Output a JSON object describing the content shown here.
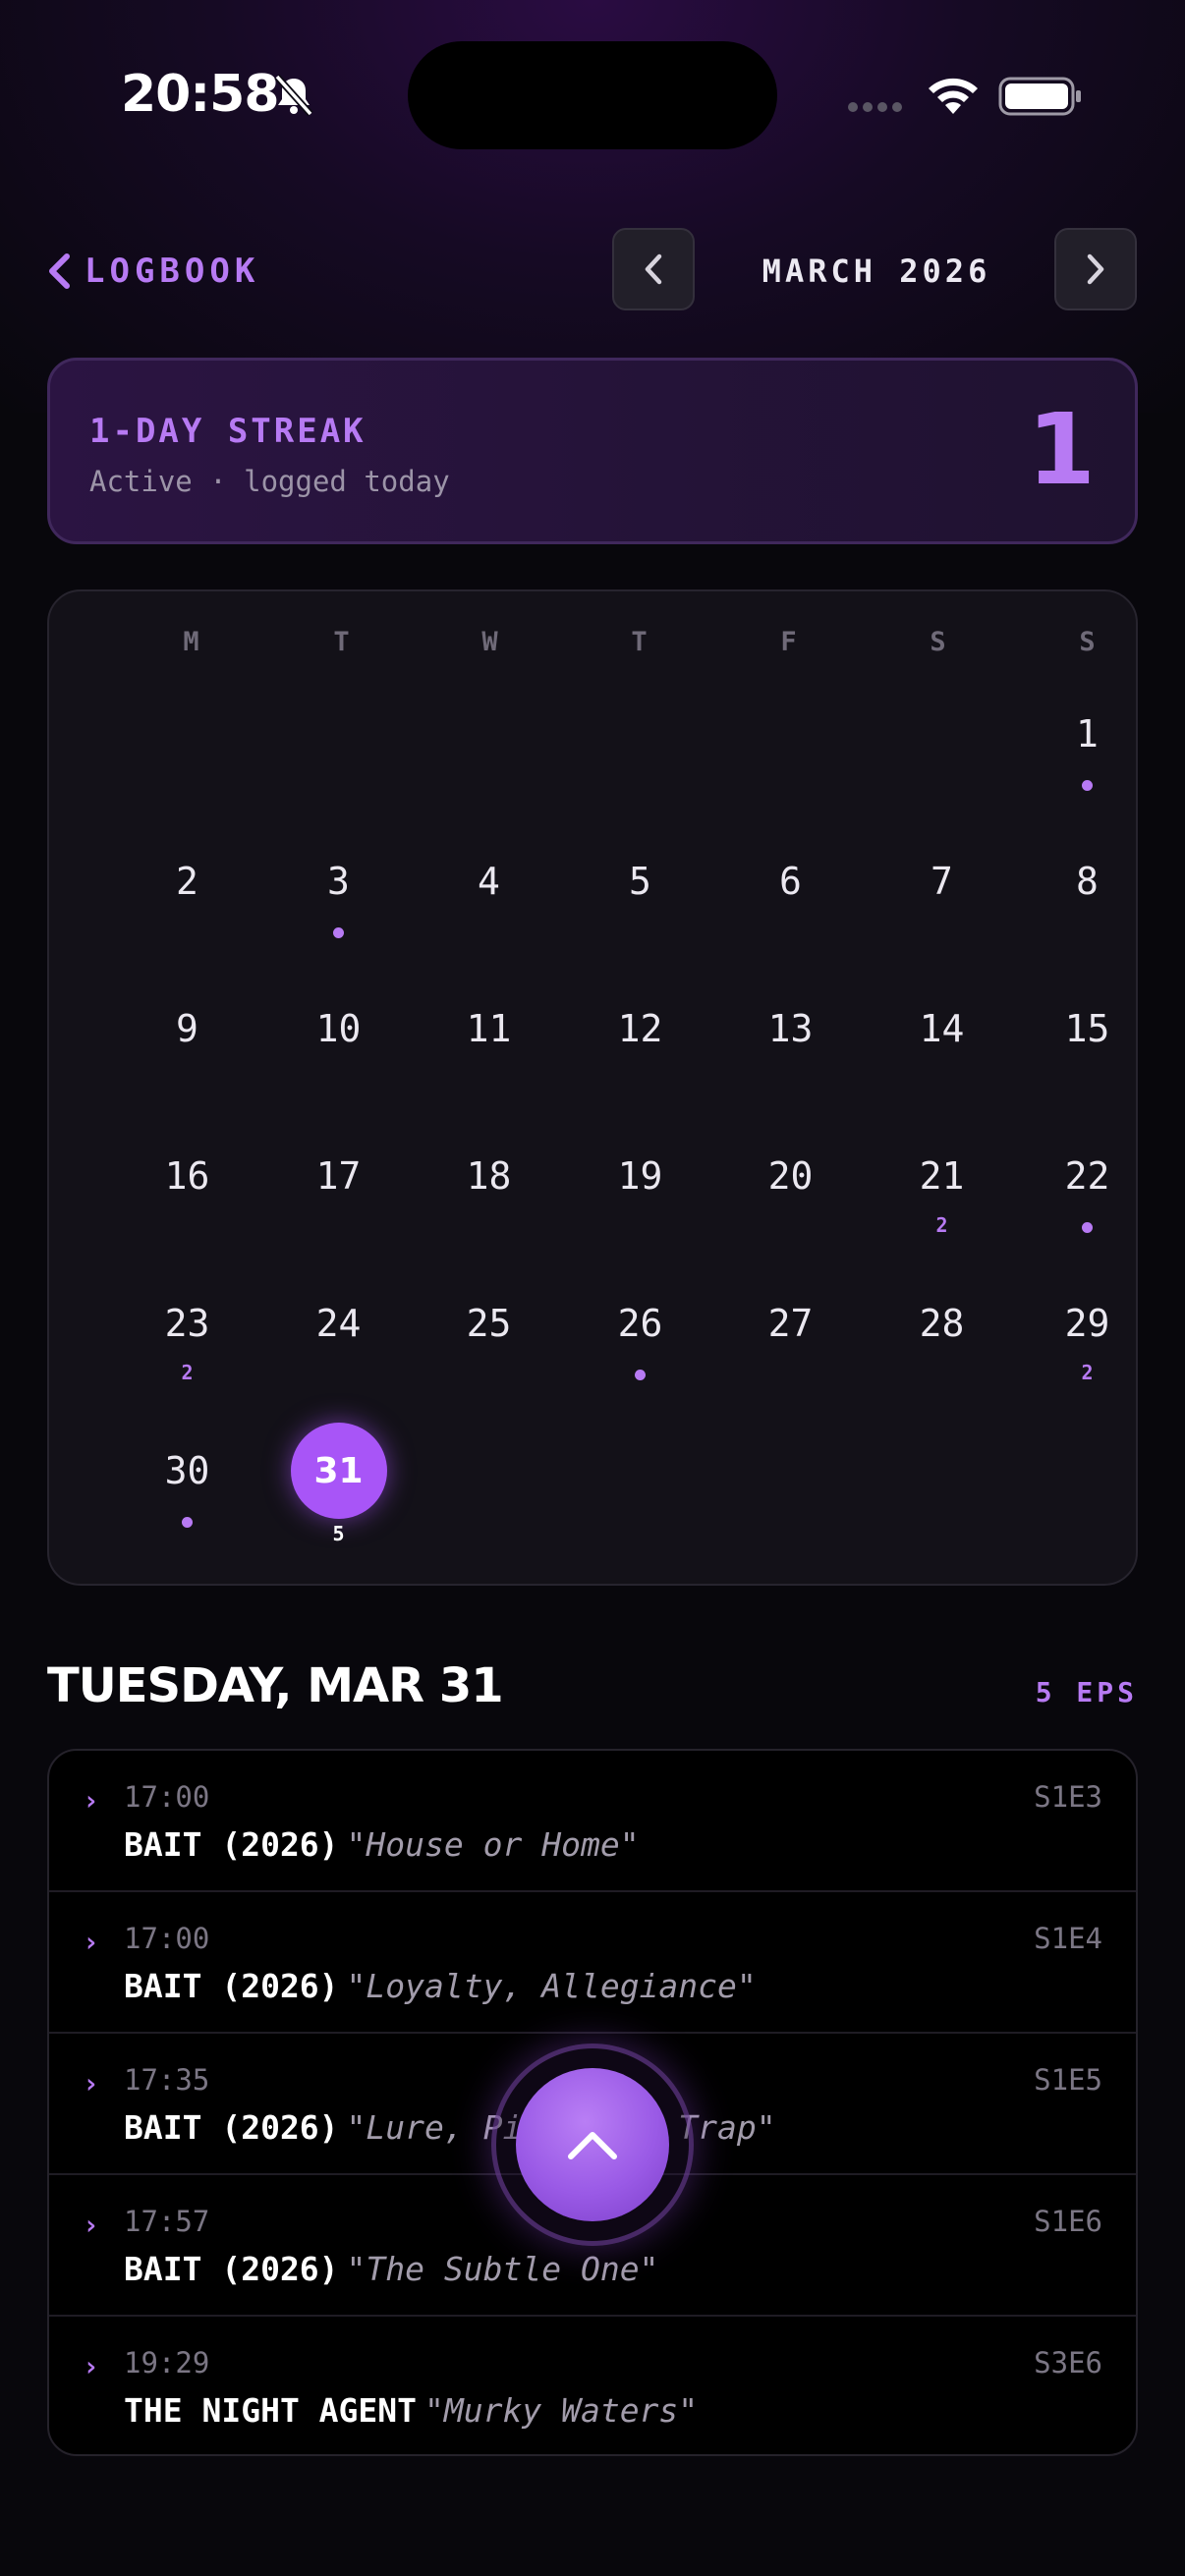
{
  "status_bar": {
    "time": "20:58"
  },
  "header": {
    "back_label": "LOGBOOK",
    "month": "MARCH 2026"
  },
  "streak": {
    "title": "1-DAY STREAK",
    "subtitle": "Active · logged today",
    "count": "1"
  },
  "calendar": {
    "weekdays": [
      "M",
      "T",
      "W",
      "T",
      "F",
      "S",
      "S"
    ],
    "days": {
      "d1": "1",
      "d2": "2",
      "d3": "3",
      "d4": "4",
      "d5": "5",
      "d6": "6",
      "d7": "7",
      "d8": "8",
      "d9": "9",
      "d10": "10",
      "d11": "11",
      "d12": "12",
      "d13": "13",
      "d14": "14",
      "d15": "15",
      "d16": "16",
      "d17": "17",
      "d18": "18",
      "d19": "19",
      "d20": "20",
      "d21": "21",
      "d22": "22",
      "d23": "23",
      "d24": "24",
      "d25": "25",
      "d26": "26",
      "d27": "27",
      "d28": "28",
      "d29": "29",
      "d30": "30",
      "d31": "31"
    },
    "counts": {
      "d21": "2",
      "d23": "2",
      "d29": "2",
      "d31": "5"
    },
    "dot_days": [
      1,
      3,
      22,
      26,
      30
    ],
    "selected_day": 31,
    "accent_color": "#a855f7"
  },
  "day_detail": {
    "title": "TUESDAY, MAR 31",
    "count_label": "5 EPS",
    "episodes": [
      {
        "time": "17:00",
        "show": "BAIT (2026)",
        "title": "\"House or Home\"",
        "code": "S1E3"
      },
      {
        "time": "17:00",
        "show": "BAIT (2026)",
        "title": "\"Loyalty, Allegiance\"",
        "code": "S1E4"
      },
      {
        "time": "17:35",
        "show": "BAIT (2026)",
        "title": "\"Lure, Pitch and Trap\"",
        "code": "S1E5"
      },
      {
        "time": "17:57",
        "show": "BAIT (2026)",
        "title": "\"The Subtle One\"",
        "code": "S1E6"
      },
      {
        "time": "19:29",
        "show": "THE NIGHT AGENT",
        "title": "\"Murky Waters\"",
        "code": "S3E6"
      }
    ]
  },
  "fab": {
    "icon": "chevron-up-icon"
  }
}
